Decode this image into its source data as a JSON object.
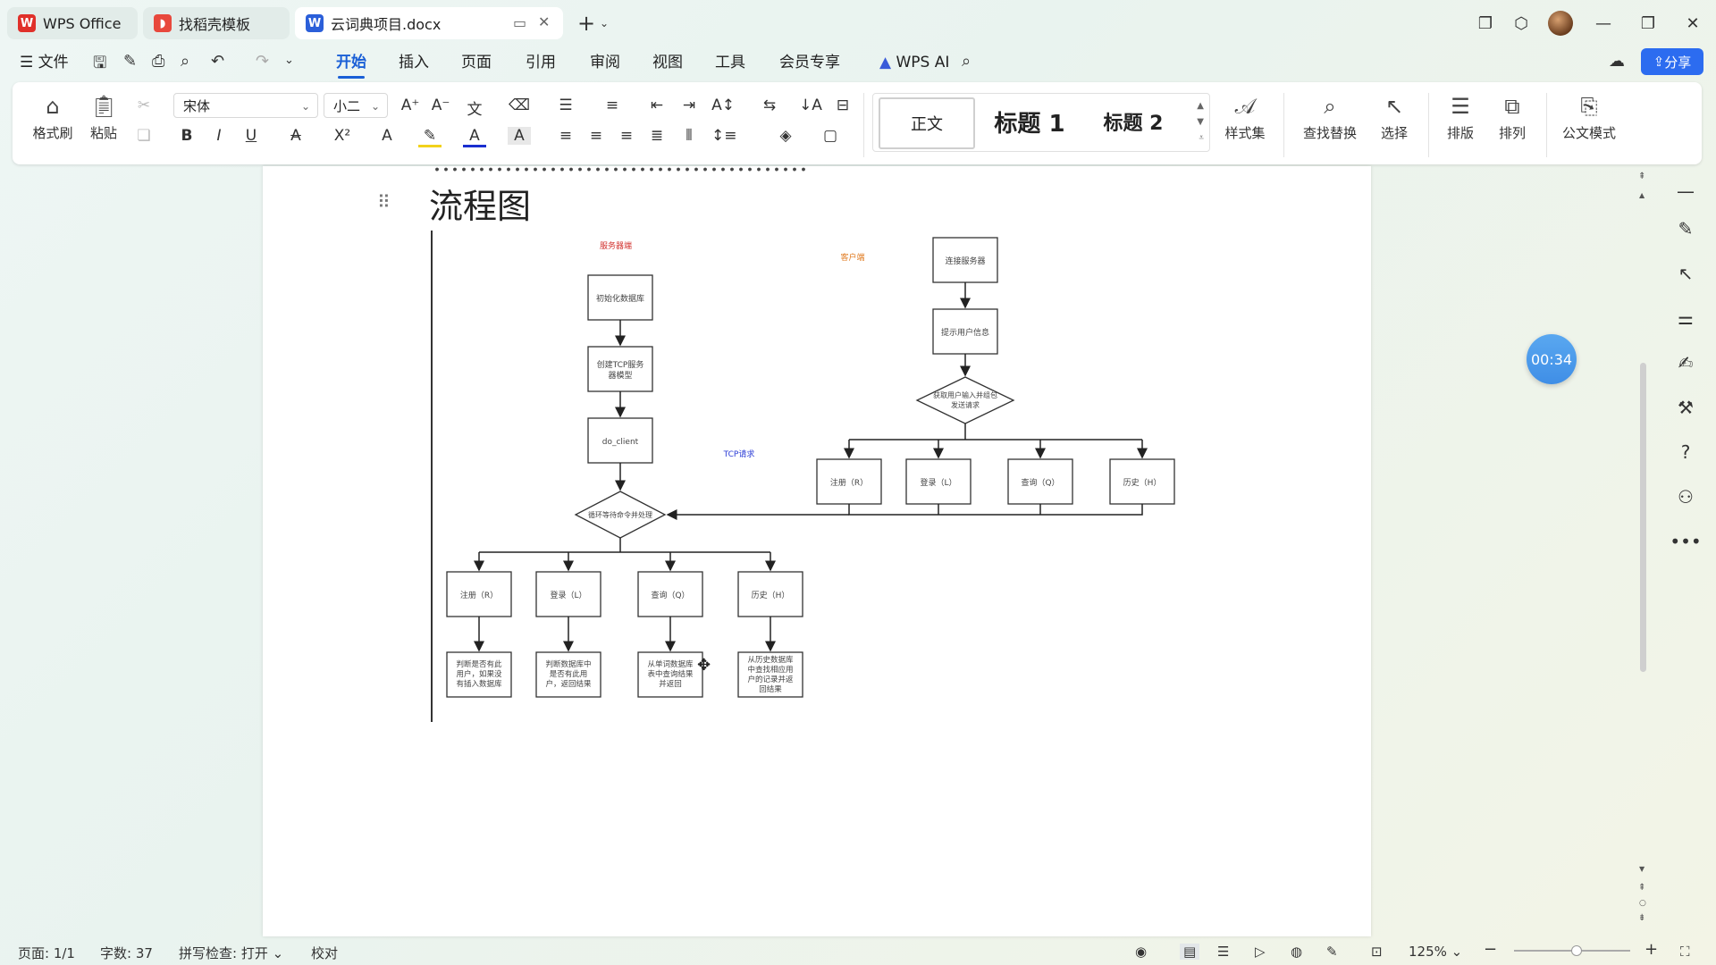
{
  "tabs": {
    "wps": "WPS Office",
    "templates": "找稻壳模板",
    "doc": "云词典项目.docx"
  },
  "menu": {
    "file": "文件",
    "items": [
      "开始",
      "插入",
      "页面",
      "引用",
      "审阅",
      "视图",
      "工具",
      "会员专享"
    ],
    "wps_ai": "WPS AI",
    "share": "分享"
  },
  "ribbon": {
    "format_painter": "格式刷",
    "paste": "粘贴",
    "font_name": "宋体",
    "font_size": "小二",
    "style_normal": "正文",
    "style_h1": "标题 1",
    "style_h2": "标题 2",
    "style_set": "样式集",
    "find_replace": "查找替换",
    "select": "选择",
    "layout": "排版",
    "arrange": "排列",
    "official": "公文模式"
  },
  "document": {
    "heading": "流程图",
    "flow": {
      "server_label": "服务器端",
      "client_label": "客户端",
      "tcp_label": "TCP请求",
      "init_db": "初始化数据库",
      "create_tcp_1": "创建TCP服务",
      "create_tcp_2": "器模型",
      "do_client": "do_client",
      "loop_wait": "循环等待命令并处理",
      "connect": "连接服务器",
      "prompt": "提示用户信息",
      "input_1": "获取用户输入并组包",
      "input_2": "发送请求",
      "register": "注册（R）",
      "login": "登录（L）",
      "query": "查询（Q）",
      "history": "历史（H）",
      "r_result": [
        "判断是否有此",
        "用户，如果没",
        "有插入数据库"
      ],
      "l_result": [
        "判断数据库中",
        "是否有此用",
        "户，返回结果"
      ],
      "q_result": [
        "从单词数据库",
        "表中查询结果",
        "并返回"
      ],
      "h_result": [
        "从历史数据库",
        "中查找相应用",
        "户的记录并返",
        "回结果"
      ]
    }
  },
  "timer": "00:34",
  "status": {
    "page": "页面: 1/1",
    "words": "字数: 37",
    "spell": "拼写检查: 打开",
    "proof": "校对",
    "zoom": "125%"
  },
  "colors": {
    "accent": "#1a5fd6",
    "share_bg": "#2c6cf0",
    "wps_red": "#e0302a",
    "word_blue": "#2b5fd9",
    "server_label": "#d2332f",
    "client_label": "#e07a1f",
    "tcp_label": "#2a3bd6"
  }
}
